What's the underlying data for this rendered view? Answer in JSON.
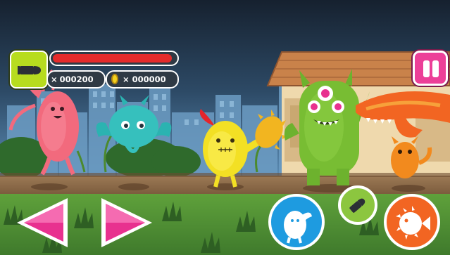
{
  "hud": {
    "weapon": {
      "icon": "bullet-icon"
    },
    "health": {
      "level": 0.97,
      "color": "#e52b2b"
    },
    "ammo": {
      "icon": "multiply-icon",
      "symbol": "×",
      "count": "000200"
    },
    "coins": {
      "icon": "coin-icon",
      "symbol": "×",
      "count": "000000"
    },
    "pause": {
      "icon": "pause-icon"
    }
  },
  "controls": {
    "left": {
      "icon": "arrow-left-icon",
      "color": "#e8318f"
    },
    "right": {
      "icon": "arrow-right-icon",
      "color": "#e8318f"
    },
    "jump": {
      "icon": "ghost-character-icon",
      "color": "#1e9be0"
    },
    "shoot": {
      "icon": "bullet-icon",
      "color": "#8cc63f"
    },
    "special": {
      "icon": "puffer-fish-icon",
      "color": "#f26522"
    }
  },
  "colors": {
    "sky_top": "#1b2a3c",
    "sky_bottom": "#4d7ea6",
    "ground": "#8a6a4a",
    "grass": "#5f9a3a"
  }
}
